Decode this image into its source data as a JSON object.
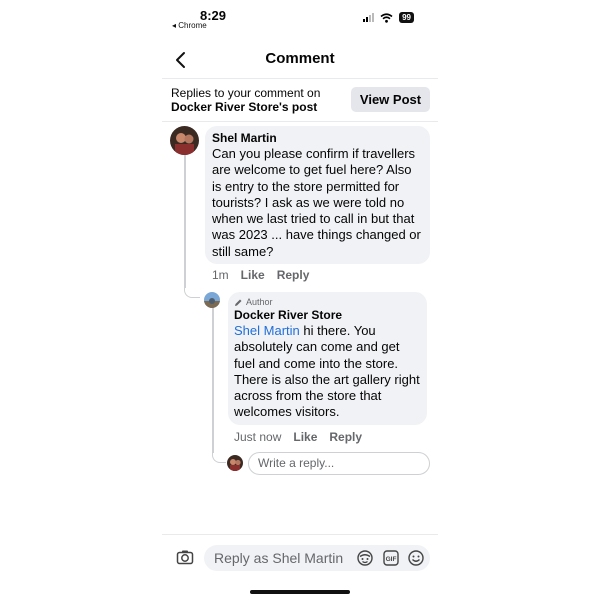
{
  "status_bar": {
    "time": "8:29",
    "back_app": "◂ Chrome",
    "battery": "99"
  },
  "header": {
    "title": "Comment",
    "back_icon": "chevron-left-icon"
  },
  "replies_bar": {
    "prefix": "Replies to your comment on",
    "page_name": "Docker River Store",
    "suffix": "'s post",
    "view_post_label": "View Post"
  },
  "comment": {
    "author": "Shel Martin",
    "text": "Can you please confirm if travellers are welcome to get fuel here? Also is entry to the store permitted for tourists? I ask as we were told no when we last tried to call in but that was 2023 ... have things changed or still same?",
    "time": "1m",
    "like_label": "Like",
    "reply_label": "Reply"
  },
  "reply": {
    "badge": "Author",
    "author": "Docker River Store",
    "mention": "Shel Martin",
    "text": " hi there. You absolutely can come and get fuel and come into the store. There is also the art gallery right across from the store that welcomes visitors.",
    "time": "Just now",
    "like_label": "Like",
    "reply_label": "Reply"
  },
  "write_reply": {
    "placeholder": "Write a reply..."
  },
  "bottom_bar": {
    "placeholder": "Reply as Shel Martin",
    "icons": [
      "camera-icon",
      "avatar-sticker-icon",
      "gif-icon",
      "emoji-icon"
    ]
  },
  "colors": {
    "accent": "#216fdb",
    "bubble": "#f0f2f5",
    "muted": "#65676b"
  }
}
